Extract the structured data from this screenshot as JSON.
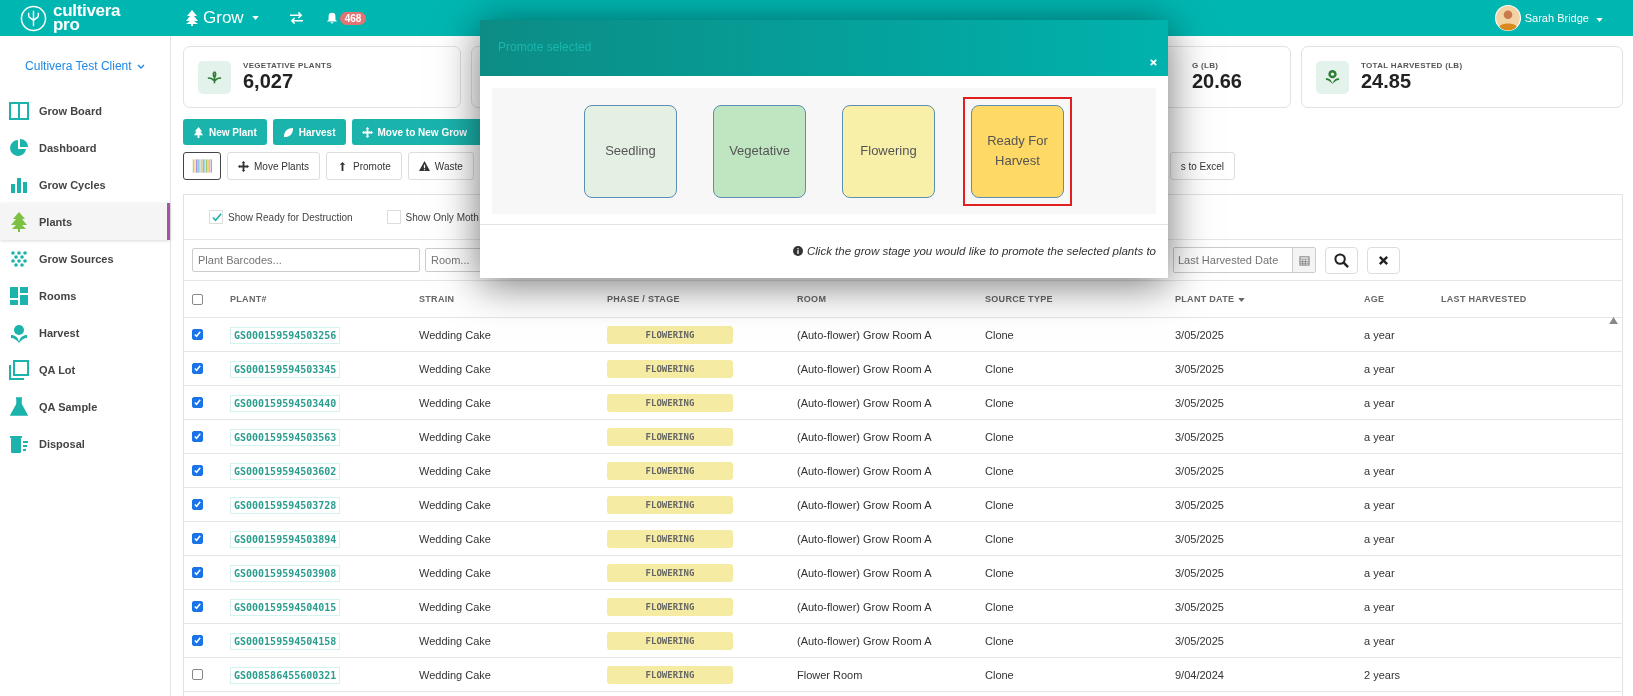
{
  "top_bar": {
    "logo_lines": [
      "cultivera",
      "pro"
    ],
    "module": "Grow",
    "notifications": "468",
    "user": "Sarah Bridge"
  },
  "sidebar": {
    "client": "Cultivera Test Client",
    "items": [
      {
        "label": "Grow Board",
        "selected": false
      },
      {
        "label": "Dashboard",
        "selected": false
      },
      {
        "label": "Grow Cycles",
        "selected": false
      },
      {
        "label": "Plants",
        "selected": true
      },
      {
        "label": "Grow Sources",
        "selected": false
      },
      {
        "label": "Rooms",
        "selected": false
      },
      {
        "label": "Harvest",
        "selected": false
      },
      {
        "label": "QA Lot",
        "selected": false
      },
      {
        "label": "QA Sample",
        "selected": false
      },
      {
        "label": "Disposal",
        "selected": false
      }
    ]
  },
  "stats": [
    {
      "kind": "full",
      "label": "VEGETATIVE PLANTS",
      "value": "6,027"
    },
    {
      "kind": "covered",
      "label": "G (LB)",
      "value": "20.66"
    },
    {
      "kind": "full",
      "label": "TOTAL HARVESTED (LB)",
      "value": "24.85"
    }
  ],
  "actions": [
    "New Plant",
    "Harvest",
    "Move to New Grow"
  ],
  "tools": [
    "Move Plants",
    "Promote",
    "Waste"
  ],
  "export": "s to Excel",
  "filters": {
    "checks": [
      {
        "label": "Show Ready for Destruction",
        "checked": true
      },
      {
        "label": "Show Only Moth",
        "checked": false
      }
    ],
    "barcode_placeholder": "Plant Barcodes...",
    "room_placeholder": "Room...",
    "harvest_date_placeholder": "Last Harvested Date"
  },
  "table": {
    "all_selected": false,
    "columns": [
      {
        "label": "PLANT#",
        "sorted": false
      },
      {
        "label": "STRAIN",
        "sorted": false
      },
      {
        "label": "PHASE / STAGE",
        "sorted": false
      },
      {
        "label": "ROOM",
        "sorted": false
      },
      {
        "label": "SOURCE TYPE",
        "sorted": false
      },
      {
        "label": "PLANT DATE",
        "sorted": true
      },
      {
        "label": "AGE",
        "sorted": false
      },
      {
        "label": "LAST HARVESTED",
        "sorted": false
      }
    ],
    "rows": [
      {
        "selected": true,
        "plant": "GS000159594503256",
        "strain": "Wedding Cake",
        "stage": "FLOWERING",
        "room": "(Auto-flower) Grow Room A",
        "source": "Clone",
        "date": "3/05/2025",
        "age": "a year"
      },
      {
        "selected": true,
        "plant": "GS000159594503345",
        "strain": "Wedding Cake",
        "stage": "FLOWERING",
        "room": "(Auto-flower) Grow Room A",
        "source": "Clone",
        "date": "3/05/2025",
        "age": "a year"
      },
      {
        "selected": true,
        "plant": "GS000159594503440",
        "strain": "Wedding Cake",
        "stage": "FLOWERING",
        "room": "(Auto-flower) Grow Room A",
        "source": "Clone",
        "date": "3/05/2025",
        "age": "a year"
      },
      {
        "selected": true,
        "plant": "GS000159594503563",
        "strain": "Wedding Cake",
        "stage": "FLOWERING",
        "room": "(Auto-flower) Grow Room A",
        "source": "Clone",
        "date": "3/05/2025",
        "age": "a year"
      },
      {
        "selected": true,
        "plant": "GS000159594503602",
        "strain": "Wedding Cake",
        "stage": "FLOWERING",
        "room": "(Auto-flower) Grow Room A",
        "source": "Clone",
        "date": "3/05/2025",
        "age": "a year"
      },
      {
        "selected": true,
        "plant": "GS000159594503728",
        "strain": "Wedding Cake",
        "stage": "FLOWERING",
        "room": "(Auto-flower) Grow Room A",
        "source": "Clone",
        "date": "3/05/2025",
        "age": "a year"
      },
      {
        "selected": true,
        "plant": "GS000159594503894",
        "strain": "Wedding Cake",
        "stage": "FLOWERING",
        "room": "(Auto-flower) Grow Room A",
        "source": "Clone",
        "date": "3/05/2025",
        "age": "a year"
      },
      {
        "selected": true,
        "plant": "GS000159594503908",
        "strain": "Wedding Cake",
        "stage": "FLOWERING",
        "room": "(Auto-flower) Grow Room A",
        "source": "Clone",
        "date": "3/05/2025",
        "age": "a year"
      },
      {
        "selected": true,
        "plant": "GS000159594504015",
        "strain": "Wedding Cake",
        "stage": "FLOWERING",
        "room": "(Auto-flower) Grow Room A",
        "source": "Clone",
        "date": "3/05/2025",
        "age": "a year"
      },
      {
        "selected": true,
        "plant": "GS000159594504158",
        "strain": "Wedding Cake",
        "stage": "FLOWERING",
        "room": "(Auto-flower) Grow Room A",
        "source": "Clone",
        "date": "3/05/2025",
        "age": "a year"
      },
      {
        "selected": false,
        "plant": "GS008586455600321",
        "strain": "Wedding Cake",
        "stage": "FLOWERING",
        "room": "Flower Room",
        "source": "Clone",
        "date": "9/04/2024",
        "age": "2 years"
      }
    ]
  },
  "modal": {
    "title": "Promote selected",
    "stages": [
      {
        "label": "Seedling",
        "color": "#e5f0e4",
        "selected": false
      },
      {
        "label": "Vegetative",
        "color": "#bfe6c1",
        "selected": false
      },
      {
        "label": "Flowering",
        "color": "#f8f0a9",
        "selected": false
      },
      {
        "label": "Ready For Harvest",
        "color": "#ffd966",
        "selected": true
      }
    ],
    "hint": "Click the grow stage you would like to promote the selected plants to"
  }
}
